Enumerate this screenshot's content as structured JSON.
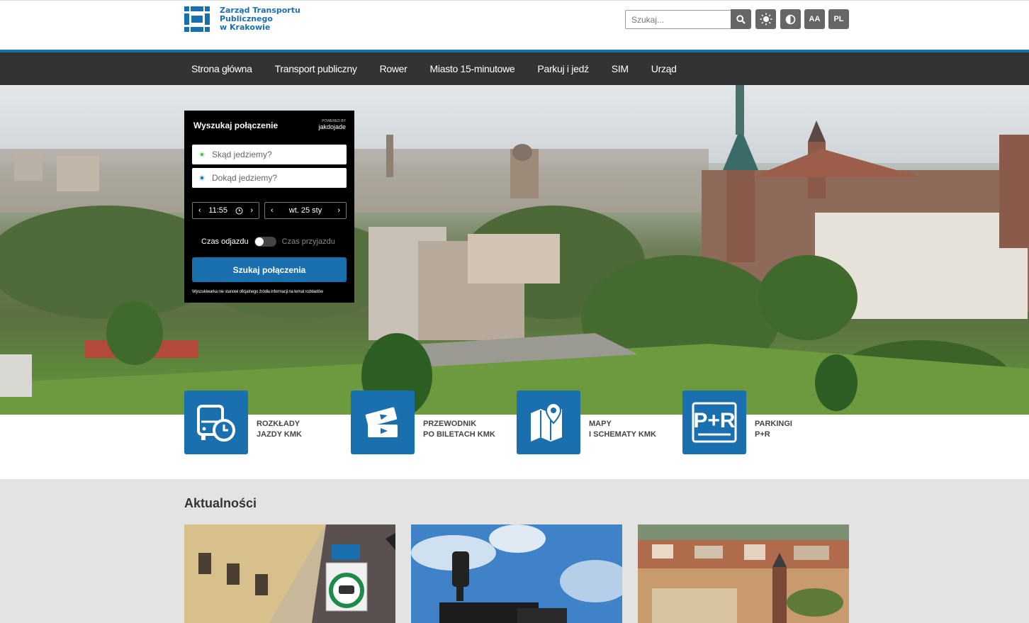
{
  "logo": {
    "line1": "Zarząd Transportu",
    "line2": "Publicznego",
    "line3": "w Krakowie"
  },
  "search": {
    "placeholder": "Szukaj..."
  },
  "tools": {
    "lang": "PL",
    "text_size": "AA"
  },
  "nav": {
    "items": [
      {
        "label": "Strona główna"
      },
      {
        "label": "Transport publiczny"
      },
      {
        "label": "Rower"
      },
      {
        "label": "Miasto 15-minutowe"
      },
      {
        "label": "Parkuj i jedź"
      },
      {
        "label": "SIM"
      },
      {
        "label": "Urząd"
      }
    ]
  },
  "widget": {
    "title": "Wyszukaj połączenie",
    "powered_by": "POWERED BY",
    "provider": "jakdojade",
    "from_placeholder": "Skąd jedziemy?",
    "to_placeholder": "Dokąd jedziemy?",
    "time": "11:55",
    "date": "wt. 25 sty",
    "departure_label": "Czas odjazdu",
    "arrival_label": "Czas przyjazdu",
    "search_button": "Szukaj połączenia",
    "disclaimer": "Wyszukiwarka nie stanowi oficjalnego źródła informacji na temat rozkładów"
  },
  "tiles": [
    {
      "line1": "ROZKŁADY",
      "line2": "JAZDY KMK",
      "icon": "bus-clock-icon"
    },
    {
      "line1": "PRZEWODNIK",
      "line2": "PO BILETACH KMK",
      "icon": "tickets-icon"
    },
    {
      "line1": "MAPY",
      "line2": "I SCHEMATY KMK",
      "icon": "map-pin-icon"
    },
    {
      "line1": "PARKINGI",
      "line2": "P+R",
      "icon": "park-and-ride-icon"
    }
  ],
  "news": {
    "title": "Aktualności"
  },
  "colors": {
    "brand_blue": "#1a6fae",
    "nav_bg": "#333333",
    "news_bg": "#e3e3e3"
  }
}
